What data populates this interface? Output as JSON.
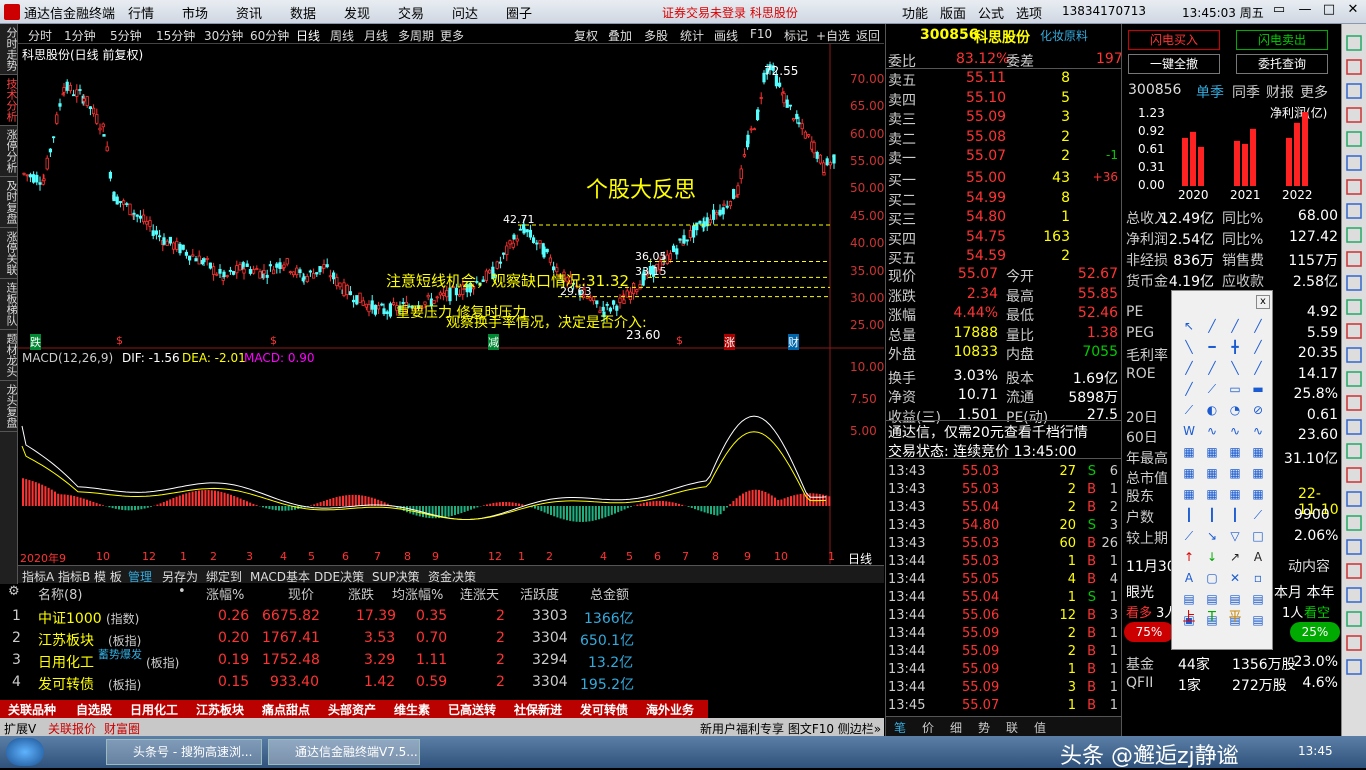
{
  "window": {
    "app_title": "通达信金融终端",
    "menu": [
      "行情",
      "市场",
      "资讯",
      "数据",
      "发现",
      "交易",
      "问达",
      "圈子"
    ],
    "notice": "证券交易未登录  科思股份",
    "menu_right": [
      "功能",
      "版面",
      "公式",
      "选项"
    ],
    "phone": "13834170713",
    "clock": "13:45:03 周五"
  },
  "left_tabs": [
    "分时走势",
    "技术分析",
    "涨停分析",
    "及时复盘",
    "涨停关联",
    "连板梯队",
    "题材龙头",
    "龙头复盘"
  ],
  "period_bar": {
    "items": [
      "分时",
      "1分钟",
      "5分钟",
      "15分钟",
      "30分钟",
      "60分钟",
      "日线",
      "周线",
      "月线",
      "多周期",
      "更多"
    ],
    "selected": "日线",
    "right_items": [
      "复权",
      "叠加",
      "多股",
      "统计",
      "画线",
      "F10",
      "标记",
      "+自选",
      "返回"
    ]
  },
  "chart": {
    "title": "科思股份(日线 前复权)",
    "annotation_big": "个股大反思",
    "annotation_1": "注意短线机会，观察缺口情况:31.32",
    "annotation_2": "重要压力 修复时压力",
    "annotation_3": "观察换手率情况，决定是否介入:",
    "high_label": "72.55",
    "low_label": "23.60",
    "level_labels": [
      "42.71",
      "36.05",
      "33.15",
      "29.63"
    ],
    "marks": [
      "跌",
      "$",
      "$",
      "减",
      "$",
      "涨",
      "财"
    ],
    "price_axis": [
      "70.00",
      "65.00",
      "60.00",
      "55.00",
      "50.00",
      "45.00",
      "40.00",
      "35.00",
      "30.00",
      "25.00"
    ],
    "macd_title": "MACD(12,26,9)",
    "dif_label": "DIF: -1.56",
    "dea_label": "DEA: -2.01",
    "macd_label": "MACD: 0.90",
    "macd_axis": [
      "10.00",
      "7.50",
      "5.00"
    ],
    "date_axis": [
      "2020年9",
      "10",
      "12",
      "1",
      "2",
      "3",
      "4",
      "5",
      "6",
      "7",
      "8",
      "9",
      "10",
      "12",
      "1",
      "2",
      "4",
      "5",
      "6",
      "7",
      "8",
      "9",
      "10",
      "1"
    ],
    "day_label": "日线"
  },
  "bottom_tabs": [
    "指标A",
    "指标B",
    "模 板",
    "管理",
    "另存为",
    "绑定到",
    "MACD基本",
    "DDE决策",
    "SUP决策",
    "资金决策"
  ],
  "board_table": {
    "headers": [
      "名称(8)",
      "•",
      "涨幅%",
      "现价",
      "涨跌",
      "均涨幅%",
      "连涨天",
      "活跃度",
      "总金额"
    ],
    "rows": [
      {
        "n": "1",
        "name": "中证1000",
        "tag": "(指数)",
        "pct": "0.26",
        "price": "6675.82",
        "chg": "17.39",
        "avg": "0.35",
        "days": "2",
        "act": "3303",
        "amt": "1366亿"
      },
      {
        "n": "2",
        "name": "江苏板块",
        "tag": "(板指)",
        "pct": "0.20",
        "price": "1767.41",
        "chg": "3.53",
        "avg": "0.70",
        "days": "2",
        "act": "3304",
        "amt": "650.1亿"
      },
      {
        "n": "3",
        "name": "日用化工",
        "tag": "(板指)",
        "pct": "0.19",
        "price": "1752.48",
        "chg": "3.29",
        "avg": "1.11",
        "days": "2",
        "act": "3294",
        "amt": "13.2亿"
      },
      {
        "n": "4",
        "name": "发可转债",
        "tag": "(板指)",
        "pct": "0.15",
        "price": "933.40",
        "chg": "1.42",
        "avg": "0.59",
        "days": "2",
        "act": "3304",
        "amt": "195.2亿"
      }
    ],
    "badge": "蓄势爆发"
  },
  "sector_bar": [
    "关联品种",
    "自选股",
    "日用化工",
    "江苏板块",
    "痛点甜点",
    "头部资产",
    "维生素",
    "已高送转",
    "社保新进",
    "发可转债",
    "海外业务"
  ],
  "status_bar": {
    "left": "扩展V",
    "tabs": [
      "关联报价",
      "财富圈"
    ],
    "right": "新用户福利专享 图文F10 侧边栏»"
  },
  "quote": {
    "code": "300856",
    "name": "科思股份",
    "sector": "化妆原料",
    "weibi": "83.12%",
    "weicha": "197",
    "sells": [
      [
        "卖五",
        "55.11",
        "8"
      ],
      [
        "卖四",
        "55.10",
        "5"
      ],
      [
        "卖三",
        "55.09",
        "3"
      ],
      [
        "卖二",
        "55.08",
        "2"
      ],
      [
        "卖一",
        "55.07",
        "2"
      ]
    ],
    "sell_delta": "-1",
    "buys": [
      [
        "买一",
        "55.00",
        "43"
      ],
      [
        "买二",
        "54.99",
        "8"
      ],
      [
        "买三",
        "54.80",
        "1"
      ],
      [
        "买四",
        "54.75",
        "163"
      ],
      [
        "买五",
        "54.59",
        "2"
      ]
    ],
    "buy_delta": "+36",
    "stats": [
      [
        "现价",
        "55.07",
        "今开",
        "52.67"
      ],
      [
        "涨跌",
        "2.34",
        "最高",
        "55.85"
      ],
      [
        "涨幅",
        "4.44%",
        "最低",
        "52.46"
      ],
      [
        "总量",
        "17888",
        "量比",
        "1.38"
      ],
      [
        "外盘",
        "10833",
        "内盘",
        "7055"
      ],
      [
        "换手",
        "3.03%",
        "股本",
        "1.69亿"
      ],
      [
        "净资",
        "10.71",
        "流通",
        "5898万"
      ],
      [
        "收益(三)",
        "1.501",
        "PE(动)",
        "27.5"
      ]
    ],
    "ad": "通达信，仅需20元查看千档行情",
    "state": "交易状态: 连续竞价 13:45:00",
    "ticks": [
      [
        "13:43",
        "55.03",
        "27",
        "S",
        "6"
      ],
      [
        "13:43",
        "55.03",
        "2",
        "B",
        "1"
      ],
      [
        "13:43",
        "55.04",
        "2",
        "B",
        "2"
      ],
      [
        "13:43",
        "54.80",
        "20",
        "S",
        "3"
      ],
      [
        "13:43",
        "55.03",
        "60",
        "B",
        "26"
      ],
      [
        "13:44",
        "55.03",
        "1",
        "B",
        "1"
      ],
      [
        "13:44",
        "55.05",
        "4",
        "B",
        "4"
      ],
      [
        "13:44",
        "55.04",
        "1",
        "S",
        "1"
      ],
      [
        "13:44",
        "55.06",
        "12",
        "B",
        "3"
      ],
      [
        "13:44",
        "55.09",
        "2",
        "B",
        "1"
      ],
      [
        "13:44",
        "55.09",
        "2",
        "B",
        "1"
      ],
      [
        "13:44",
        "55.09",
        "1",
        "B",
        "1"
      ],
      [
        "13:44",
        "55.09",
        "3",
        "B",
        "1"
      ],
      [
        "13:45",
        "55.07",
        "1",
        "B",
        "1"
      ]
    ],
    "bottom_tabs": [
      "笔",
      "价",
      "细",
      "势",
      "联",
      "值"
    ]
  },
  "f10": {
    "btn_buy": "闪电买入",
    "btn_sell": "闪电卖出",
    "btn_cancel_all": "一键全撤",
    "btn_query": "委托查询",
    "code": "300856",
    "tabs": [
      "单季",
      "同季",
      "财报",
      "更多"
    ],
    "chart_title": "净利润(亿)",
    "years": [
      "2020",
      "2021",
      "2022"
    ],
    "bars": [
      0.8,
      0.9,
      0.65,
      0.75,
      0.7,
      0.95,
      0.8,
      1.05,
      1.23
    ],
    "yaxis": [
      "1.23",
      "0.92",
      "0.61",
      "0.31",
      "0.00"
    ],
    "rows": [
      [
        "总收入",
        "12.49亿",
        "同比%",
        "68.00"
      ],
      [
        "净利润",
        "2.54亿",
        "同比%",
        "127.42"
      ],
      [
        "非经损",
        "836万",
        "销售费",
        "1157万"
      ],
      [
        "货币金",
        "4.19亿",
        "应收款",
        "2.58亿"
      ]
    ],
    "rows2": [
      [
        "PE",
        "4.92"
      ],
      [
        "PEG",
        "5.59"
      ],
      [
        "毛利率",
        "20.35"
      ],
      [
        "ROE",
        "14.17"
      ],
      [
        "",
        "25.8%"
      ],
      [
        "20日",
        "0.61"
      ],
      [
        "60日",
        "23.60"
      ],
      [
        "年最高",
        "31.10亿"
      ],
      [
        "总市值",
        ""
      ]
    ],
    "date": "22-11-10",
    "shareholders": "9900",
    "pct": "2.06%",
    "extra": [
      "股东",
      "户数",
      "较上期"
    ],
    "time_row": "11月30",
    "time_tail": "动内容",
    "guang": "眼光",
    "month": "本月 本年",
    "p1": "3人",
    "p2": "1人",
    "rate_red": "75%",
    "rate_grn": "25%",
    "fund": [
      [
        "基金",
        "44家",
        "1356万股",
        "23.0%"
      ],
      [
        "QFII",
        "1家",
        "272万股",
        "4.6%"
      ]
    ],
    "see_more": "看多",
    "see_empty": "看空"
  },
  "taskbar": {
    "items": [
      "头条号 - 搜狗高速浏...",
      "通达信金融终端V7.5..."
    ],
    "watermark": "头条 @邂逅zj静谧",
    "time": "13:45"
  }
}
